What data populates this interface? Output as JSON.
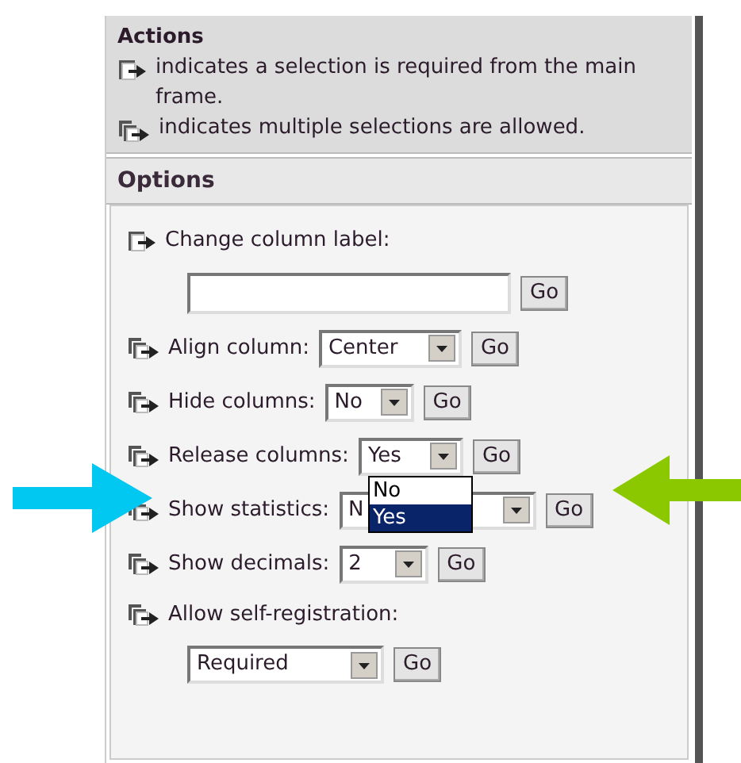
{
  "actions": {
    "title": "Actions",
    "notes": [
      {
        "kind": "single",
        "text": "indicates a selection is required from the main frame."
      },
      {
        "kind": "multiple",
        "text": "indicates multiple selections are allowed."
      }
    ]
  },
  "options": {
    "title": "Options",
    "items": [
      {
        "kind": "single-text",
        "label": "Change column label:",
        "button": "Go"
      },
      {
        "kind": "multiple-select",
        "label": "Align column:",
        "value": "Center",
        "button": "Go"
      },
      {
        "kind": "multiple-select",
        "label": "Hide columns:",
        "value": "No",
        "button": "Go"
      },
      {
        "kind": "multiple-select",
        "label": "Release columns:",
        "value": "Yes",
        "button": "Go",
        "expanded": true,
        "choices": [
          {
            "label": "No",
            "selected": false
          },
          {
            "label": "Yes",
            "selected": true
          }
        ]
      },
      {
        "kind": "multiple-select",
        "label": "Show statistics:",
        "value": "N",
        "button": "Go"
      },
      {
        "kind": "multiple-select",
        "label": "Show decimals:",
        "value": "2",
        "button": "Go"
      },
      {
        "kind": "multiple-select-below",
        "label": "Allow self-registration:",
        "value": "Required",
        "button": "Go"
      }
    ]
  }
}
